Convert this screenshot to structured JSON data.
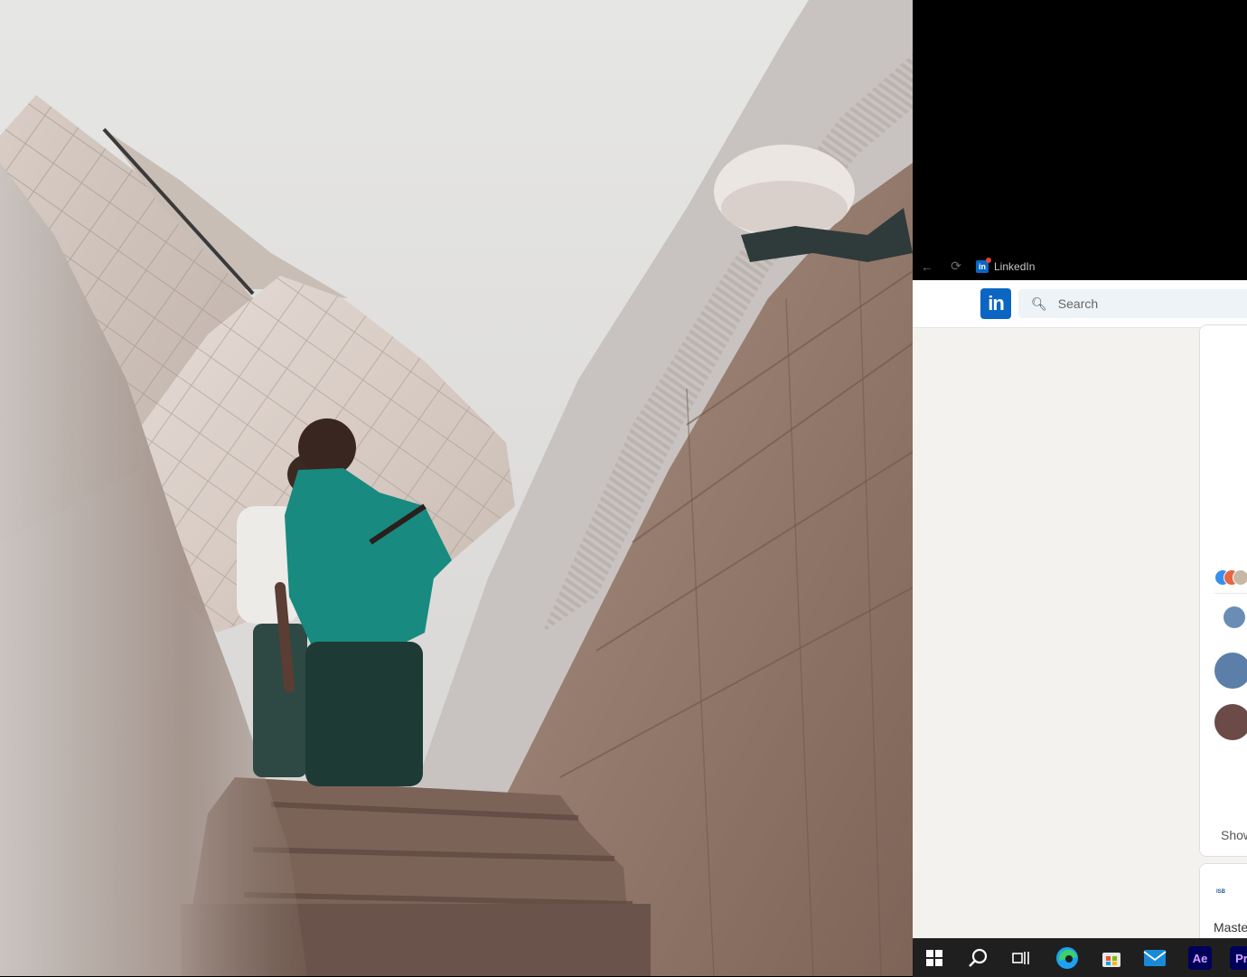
{
  "browser": {
    "tab": {
      "title": "LinkedIn",
      "favicon": "linkedin-icon"
    },
    "nav": {
      "back_icon": "back-arrow-icon",
      "reload_icon": "reload-icon"
    }
  },
  "linkedin": {
    "logo_text": "in",
    "search": {
      "placeholder": "Search",
      "icon": "search-icon"
    },
    "card1": {
      "show_more": "Show"
    },
    "card2": {
      "logo_text": "ISB",
      "text": "Maste"
    }
  },
  "taskbar": {
    "items": [
      {
        "name": "start-button",
        "icon": "windows-icon"
      },
      {
        "name": "search-button",
        "icon": "search-icon"
      },
      {
        "name": "task-view-button",
        "icon": "task-view-icon"
      },
      {
        "name": "edge-button",
        "icon": "edge-icon"
      },
      {
        "name": "store-button",
        "icon": "store-icon"
      },
      {
        "name": "mail-button",
        "icon": "mail-icon"
      },
      {
        "name": "after-effects-button",
        "icon": "after-effects-icon",
        "label": "Ae"
      },
      {
        "name": "premiere-button",
        "icon": "premiere-icon",
        "label": "Pr"
      }
    ]
  },
  "colors": {
    "linkedin_blue": "#0a66c2",
    "page_bg": "#f4f2ee",
    "taskbar_bg": "#1f1f1f"
  }
}
